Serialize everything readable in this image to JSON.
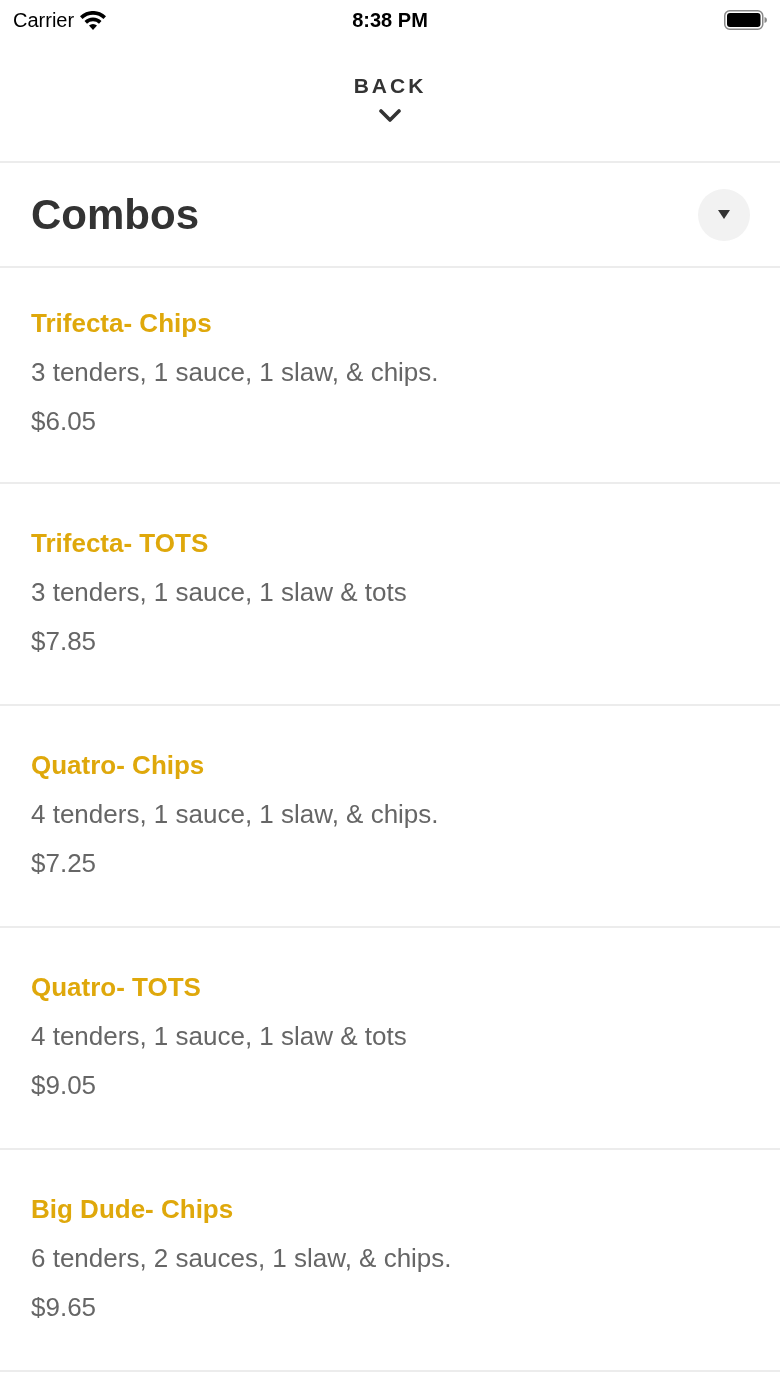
{
  "status_bar": {
    "carrier": "Carrier",
    "time": "8:38 PM"
  },
  "header": {
    "back_label": "BACK"
  },
  "section": {
    "title": "Combos"
  },
  "items": [
    {
      "name": "Trifecta- Chips",
      "description": "3 tenders, 1 sauce, 1 slaw, & chips.",
      "price": "$6.05"
    },
    {
      "name": "Trifecta- TOTS",
      "description": "3 tenders, 1 sauce, 1 slaw & tots",
      "price": "$7.85"
    },
    {
      "name": "Quatro- Chips",
      "description": "4 tenders, 1 sauce, 1 slaw, & chips.",
      "price": "$7.25"
    },
    {
      "name": "Quatro- TOTS",
      "description": "4 tenders, 1 sauce, 1 slaw & tots",
      "price": "$9.05"
    },
    {
      "name": "Big Dude- Chips",
      "description": "6 tenders, 2 sauces, 1 slaw, & chips.",
      "price": "$9.65"
    }
  ]
}
